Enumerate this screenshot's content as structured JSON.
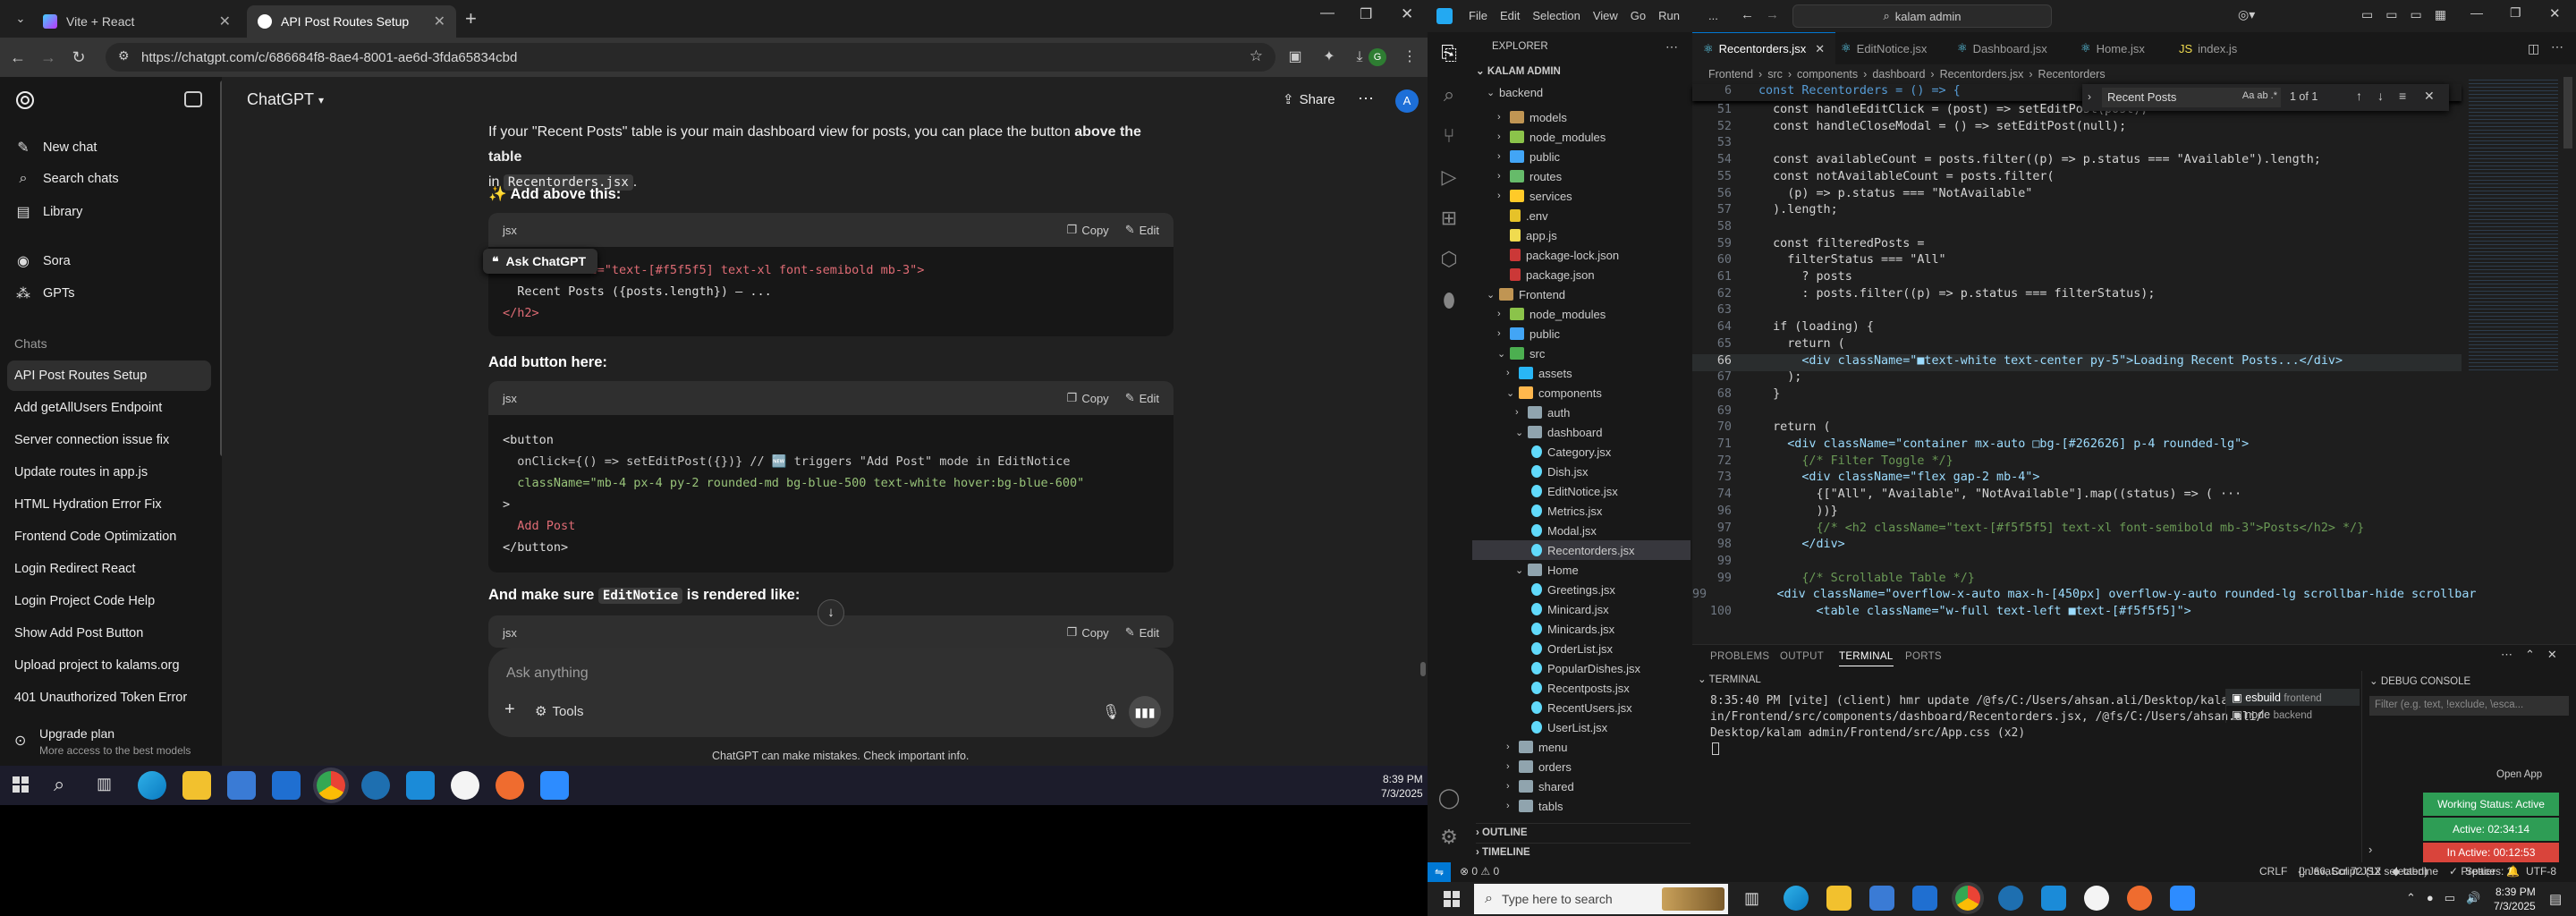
{
  "browser": {
    "tabs": [
      {
        "label": "Vite + React"
      },
      {
        "label": "API Post Routes Setup"
      }
    ],
    "url": "https://chatgpt.com/c/686684f8-8ae4-8001-ae6d-3fda65834cbd"
  },
  "chatgpt": {
    "brand": "ChatGPT",
    "share_label": "Share",
    "avatar_initial": "A",
    "nav": [
      {
        "label": "New chat"
      },
      {
        "label": "Search chats"
      },
      {
        "label": "Library"
      },
      {
        "label": "Sora"
      },
      {
        "label": "GPTs"
      }
    ],
    "chats_heading": "Chats",
    "chats": [
      {
        "label": "API Post Routes Setup"
      },
      {
        "label": "Add getAllUsers Endpoint"
      },
      {
        "label": "Server connection issue fix"
      },
      {
        "label": "Update routes in app.js"
      },
      {
        "label": "HTML Hydration Error Fix"
      },
      {
        "label": "Frontend Code Optimization"
      },
      {
        "label": "Login Redirect React"
      },
      {
        "label": "Login Project Code Help"
      },
      {
        "label": "Show Add Post Button"
      },
      {
        "label": "Upload project to kalams.org"
      },
      {
        "label": "401 Unauthorized Token Error"
      }
    ],
    "upgrade": {
      "title": "Upgrade plan",
      "subtitle": "More access to the best models"
    },
    "message": {
      "intro_a": "If your \"Recent Posts\" table is your main dashboard view for posts, you can place the button ",
      "intro_bold": "above the table",
      "intro_b": "in",
      "intro_code": "Recentorders.jsx",
      "intro_end": ".",
      "h1": "✨ Add above this:",
      "h2": "Add button here:",
      "h3_a": "And make sure",
      "h3_code": "EditNotice",
      "h3_b": "is rendered like:",
      "code_lang": "jsx",
      "copy_label": "Copy",
      "edit_label": "Edit",
      "ask_chatgpt": "Ask ChatGPT",
      "block1": [
        "<h2 className=\"text-[#f5f5f5] text-xl font-semibold mb-3\">",
        "  Recent Posts ({posts.length}) — ...",
        "</h2>"
      ],
      "block2": [
        "<button",
        "  onClick={() => setEditPost({})} // 🆕 triggers \"Add Post\" mode in EditNotice",
        "  className=\"mb-4 px-4 py-2 rounded-md bg-blue-500 text-white hover:bg-blue-600\"",
        ">",
        "  Add Post",
        "</button>"
      ]
    },
    "composer_placeholder": "Ask anything",
    "tools_label": "Tools",
    "disclaimer": "ChatGPT can make mistakes. Check important info."
  },
  "taskbar1": {
    "time": "8:39 PM",
    "date": "7/3/2025"
  },
  "vscode": {
    "menu": [
      "File",
      "Edit",
      "Selection",
      "View",
      "Go",
      "Run",
      "..."
    ],
    "search": "kalam admin",
    "explorer_title": "EXPLORER",
    "root": "KALAM ADMIN",
    "tree": [
      "backend",
      "models",
      "node_modules",
      "public",
      "routes",
      "services",
      ".env",
      "app.js",
      "package-lock.json",
      "package.json",
      "Frontend",
      "node_modules",
      "public",
      "src",
      "assets",
      "components",
      "auth",
      "dashboard",
      "Category.jsx",
      "Dish.jsx",
      "EditNotice.jsx",
      "Metrics.jsx",
      "Modal.jsx",
      "Recentorders.jsx",
      "Home",
      "Greetings.jsx",
      "Minicard.jsx",
      "Minicards.jsx",
      "OrderList.jsx",
      "PopularDishes.jsx",
      "Recentposts.jsx",
      "RecentUsers.jsx",
      "UserList.jsx",
      "menu",
      "orders",
      "shared",
      "tabls"
    ],
    "outline": "OUTLINE",
    "timeline": "TIMELINE",
    "tabs": [
      "Recentorders.jsx",
      "EditNotice.jsx",
      "Dashboard.jsx",
      "Home.jsx",
      "index.js"
    ],
    "breadcrumb": [
      "Frontend",
      "src",
      "components",
      "dashboard",
      "Recentorders.jsx",
      "Recentorders"
    ],
    "find_query": "Recent Posts",
    "find_result": "1 of 1",
    "sticky_line_no": "6",
    "sticky_line": "const Recentorders = () => {",
    "code_lines": [
      {
        "n": "51",
        "t": "  const handleEditClick = (post) => setEditPost(post);"
      },
      {
        "n": "52",
        "t": "  const handleCloseModal = () => setEditPost(null);"
      },
      {
        "n": "53",
        "t": ""
      },
      {
        "n": "54",
        "t": "  const availableCount = posts.filter((p) => p.status === \"Available\").length;"
      },
      {
        "n": "55",
        "t": "  const notAvailableCount = posts.filter("
      },
      {
        "n": "56",
        "t": "    (p) => p.status === \"NotAvailable\""
      },
      {
        "n": "57",
        "t": "  ).length;"
      },
      {
        "n": "58",
        "t": ""
      },
      {
        "n": "59",
        "t": "  const filteredPosts ="
      },
      {
        "n": "60",
        "t": "    filterStatus === \"All\""
      },
      {
        "n": "61",
        "t": "      ? posts"
      },
      {
        "n": "62",
        "t": "      : posts.filter((p) => p.status === filterStatus);"
      },
      {
        "n": "63",
        "t": ""
      },
      {
        "n": "64",
        "t": "  if (loading) {"
      },
      {
        "n": "65",
        "t": "    return ("
      },
      {
        "n": "66",
        "t": "      <div className=\"■text-white text-center py-5\">Loading Recent Posts...</div>"
      },
      {
        "n": "67",
        "t": "    );"
      },
      {
        "n": "68",
        "t": "  }"
      },
      {
        "n": "69",
        "t": ""
      },
      {
        "n": "70",
        "t": "  return ("
      },
      {
        "n": "71",
        "t": "    <div className=\"container mx-auto □bg-[#262626] p-4 rounded-lg\">"
      },
      {
        "n": "72",
        "t": "      {/* Filter Toggle */}"
      },
      {
        "n": "73",
        "t": "      <div className=\"flex gap-2 mb-4\">"
      },
      {
        "n": "74",
        "t": "        {[\"All\", \"Available\", \"NotAvailable\"].map((status) => ( ···"
      },
      {
        "n": "96",
        "t": "        ))}"
      },
      {
        "n": "97",
        "t": "        {/* <h2 className=\"text-[#f5f5f5] text-xl font-semibold mb-3\">Posts</h2> */}"
      },
      {
        "n": "98",
        "t": "      </div>"
      },
      {
        "n": "99",
        "t": ""
      },
      {
        "n": "99",
        "t": "      {/* Scrollable Table */}"
      },
      {
        "n": "99",
        "t": "      <div className=\"overflow-x-auto max-h-[450px] overflow-y-auto rounded-lg scrollbar-hide scrollbar"
      },
      {
        "n": "100",
        "t": "        <table className=\"w-full text-left ■text-[#f5f5f5]\">"
      }
    ],
    "panel_tabs": [
      "PROBLEMS",
      "OUTPUT",
      "TERMINAL",
      "PORTS"
    ],
    "terminal_title": "TERMINAL",
    "terminal_lines": [
      "8:35:40 PM [vite] (client) hmr update /@fs/C:/Users/ahsan.ali/Desktop/kalam adm",
      "in/Frontend/src/components/dashboard/Recentorders.jsx, /@fs/C:/Users/ahsan.ali/",
      "Desktop/kalam admin/Frontend/src/App.css (x2)"
    ],
    "terminals": [
      {
        "label": "esbuild",
        "sub": "frontend"
      },
      {
        "label": "node",
        "sub": "backend"
      }
    ],
    "debug_console": "DEBUG CONSOLE",
    "debug_filter": "Filter (e.g. text, !exclude, \\esca...",
    "open_app": "Open App",
    "working_status": "Working Status: Active",
    "active_time": "Active: 02:34:14",
    "inactive_time": "In Active: 00:12:53",
    "status": {
      "errors": "0",
      "warnings": "0",
      "position": "Ln 66, Col 72 (12 selected)",
      "spaces": "Spaces: 2",
      "encoding": "UTF-8",
      "eol": "CRLF",
      "language": "JavaScript JSX",
      "tabnine": "tabnine",
      "prettier": "Prettier"
    }
  },
  "taskbar2": {
    "search_placeholder": "Type here to search",
    "time": "8:39 PM",
    "date": "7/3/2025"
  }
}
